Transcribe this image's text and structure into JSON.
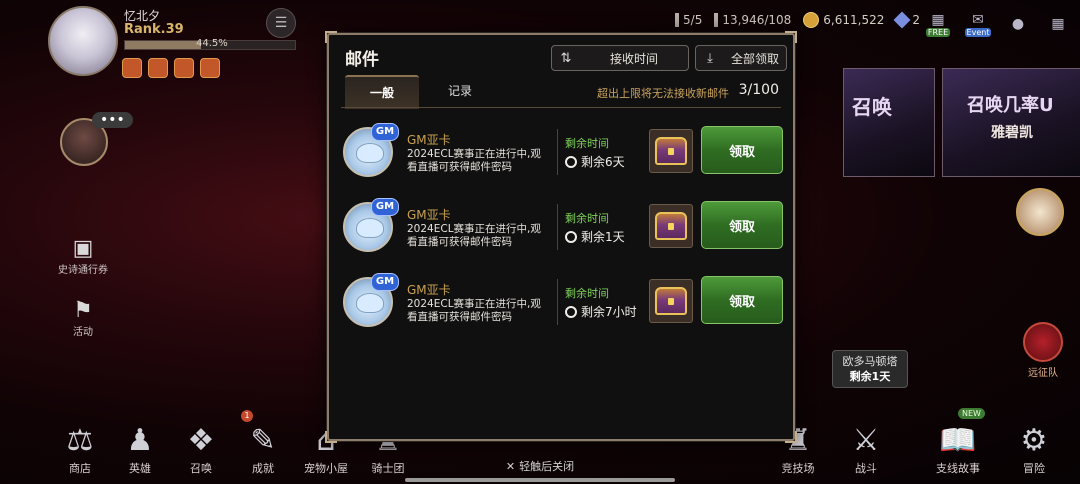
{
  "player": {
    "name": "忆北夕",
    "rank": "Rank.39",
    "exp_percent": "44.5%",
    "exp_fraction": 0.445
  },
  "resources": {
    "stamina": "5/5",
    "arena": "13,946/108",
    "gold": "6,611,522",
    "gems": "2"
  },
  "top_icons": {
    "free_tag": "FREE",
    "event_tag": "Event",
    "event_count": "3"
  },
  "left_side": {
    "epic_pass_label": "史诗通行券",
    "activity_label": "活动"
  },
  "right_side": {
    "banner_left_text": "召唤",
    "banner_right_title": "召唤几率U",
    "banner_right_sub": "雅碧凯",
    "expedition_label": "远征队",
    "tooltip_title": "欧多马顿塔",
    "tooltip_value": "剩余1天"
  },
  "bottom_nav": [
    {
      "label": "商店",
      "icon": "shop-icon"
    },
    {
      "label": "英雄",
      "icon": "hero-icon"
    },
    {
      "label": "召唤",
      "icon": "summon-icon"
    },
    {
      "label": "成就",
      "icon": "achievement-icon",
      "badge": "1"
    },
    {
      "label": "宠物小屋",
      "icon": "pet-house-icon"
    },
    {
      "label": "骑士团",
      "icon": "knights-icon"
    },
    {
      "label": "竞技场",
      "icon": "arena-icon"
    },
    {
      "label": "战斗",
      "icon": "battle-icon"
    },
    {
      "label": "支线故事",
      "icon": "side-story-icon",
      "new_tag": "NEW"
    },
    {
      "label": "冒险",
      "icon": "adventure-icon"
    }
  ],
  "close_hint": "轻触后关闭",
  "mail": {
    "title": "邮件",
    "sort_label": "接收时间",
    "claim_all_label": "全部领取",
    "tabs": [
      {
        "label": "一般"
      },
      {
        "label": "记录"
      }
    ],
    "limit_text": "超出上限将无法接收新邮件",
    "limit_count": "3/100",
    "gm_badge": "GM",
    "remaining_label": "剩余时间",
    "claim_label": "领取",
    "items": [
      {
        "sender": "GM亚卡",
        "body": "2024ECL赛事正在进行中,观看直播可获得邮件密码",
        "remaining": "剩余6天"
      },
      {
        "sender": "GM亚卡",
        "body": "2024ECL赛事正在进行中,观看直播可获得邮件密码",
        "remaining": "剩余1天"
      },
      {
        "sender": "GM亚卡",
        "body": "2024ECL赛事正在进行中,观看直播可获得邮件密码",
        "remaining": "剩余7小时"
      }
    ]
  },
  "colors": {
    "accent_gold": "#c9a35e",
    "claim_green": "#3f8a2e",
    "remaining_green": "#7ed35a",
    "gm_blue": "#2f63d6"
  }
}
